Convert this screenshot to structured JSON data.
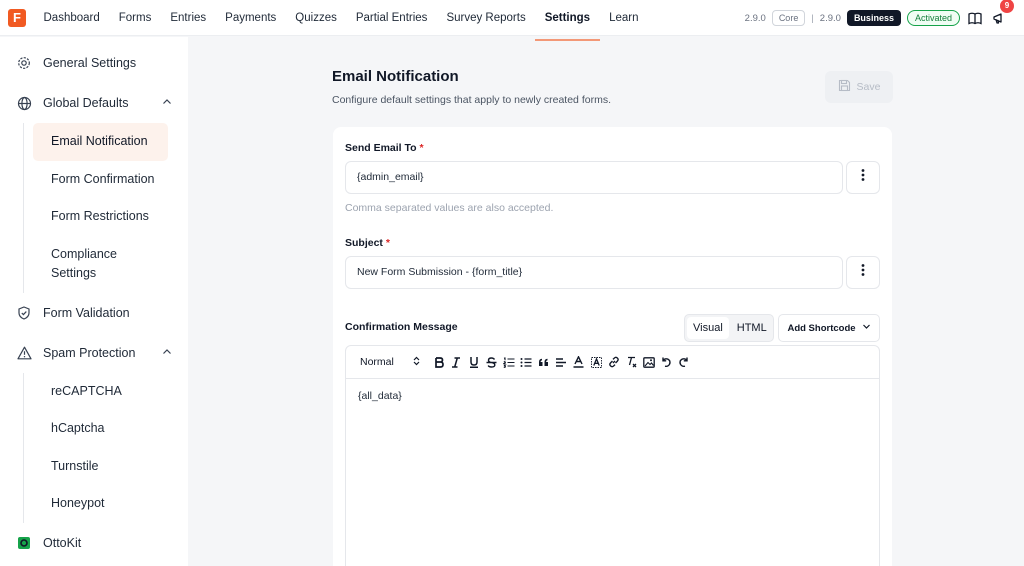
{
  "app": {
    "logo_letter": "F"
  },
  "nav": {
    "items": [
      "Dashboard",
      "Forms",
      "Entries",
      "Payments",
      "Quizzes",
      "Partial Entries",
      "Survey Reports",
      "Settings",
      "Learn"
    ],
    "active": "Settings"
  },
  "versions": {
    "core_version": "2.9.0",
    "core_label": "Core",
    "separator": "|",
    "business_version": "2.9.0",
    "business_label": "Business",
    "status": "Activated",
    "notification_count": "9"
  },
  "sidebar": {
    "general": "General Settings",
    "global_defaults": "Global Defaults",
    "global_items": [
      "Email Notification",
      "Form Confirmation",
      "Form Restrictions",
      "Compliance Settings"
    ],
    "form_validation": "Form Validation",
    "spam_protection": "Spam Protection",
    "spam_items": [
      "reCAPTCHA",
      "hCaptcha",
      "Turnstile",
      "Honeypot"
    ],
    "ottokit": "OttoKit"
  },
  "main": {
    "title": "Email Notification",
    "description": "Configure default settings that apply to newly created forms.",
    "save_label": "Save",
    "send_to_label": "Send Email To",
    "send_to_value": "{admin_email}",
    "send_to_help": "Comma separated values are also accepted.",
    "subject_label": "Subject",
    "subject_value": "New Form Submission - {form_title}",
    "required_mark": "*",
    "message_label": "Confirmation Message",
    "tab_visual": "Visual",
    "tab_html": "HTML",
    "add_shortcode": "Add Shortcode",
    "editor_format": "Normal",
    "editor_content": "{all_data}"
  },
  "colors": {
    "accent": "#f15a22",
    "required": "#dc2626",
    "activated": "#15803d"
  },
  "icons": {
    "toolbar": [
      "bold-icon",
      "italic-icon",
      "underline-icon",
      "strikethrough-icon",
      "ordered-list-icon",
      "bullet-list-icon",
      "blockquote-icon",
      "align-icon",
      "text-color-icon",
      "background-color-icon",
      "link-icon",
      "clear-format-icon",
      "image-icon",
      "undo-icon",
      "redo-icon"
    ]
  }
}
